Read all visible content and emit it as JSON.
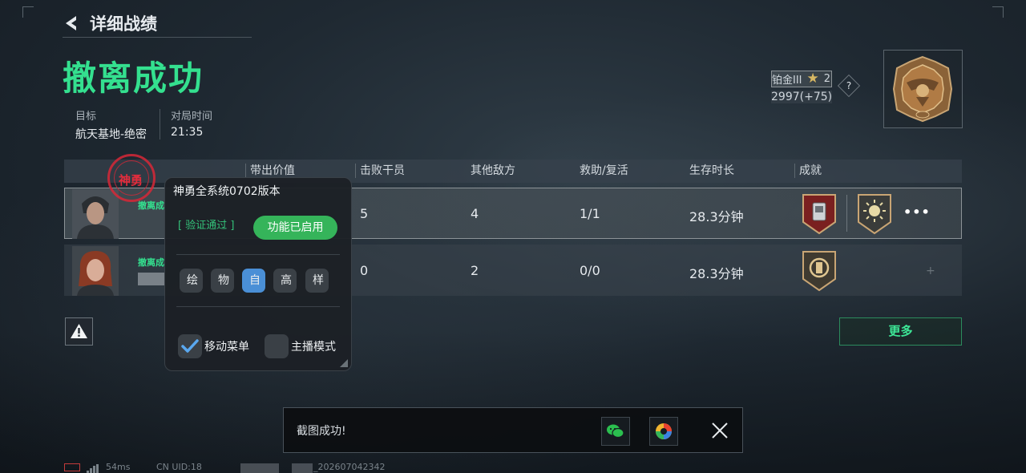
{
  "header": {
    "back_label": "详细战绩",
    "result": "撤离成功"
  },
  "meta": {
    "target_label": "目标",
    "target_value": "航天基地-绝密",
    "time_label": "对局时间",
    "time_value": "21:35"
  },
  "rank": {
    "tier": "铂金III",
    "stars": "2",
    "score": "2997(+75)",
    "help": "?"
  },
  "table": {
    "headers": [
      "带出价值",
      "击败干员",
      "其他敌方",
      "救助/复活",
      "生存时长",
      "成就"
    ],
    "rows": [
      {
        "name": "撤离成",
        "kills": "5",
        "others": "4",
        "assists": "1/1",
        "survival": "28.3分钟",
        "more": "•••"
      },
      {
        "name": "撤离成",
        "kills": "0",
        "others": "2",
        "assists": "0/0",
        "survival": "28.3分钟"
      }
    ]
  },
  "stamp": {
    "text": "神勇"
  },
  "popup": {
    "title": "神勇全系统0702版本",
    "verified": "[ 验证通过 ]",
    "enabled_button": "功能已启用",
    "chips": [
      "绘",
      "物",
      "自",
      "高",
      "样"
    ],
    "move_menu_label": "移动菜单",
    "streamer_label": "主播模式"
  },
  "buttons": {
    "more": "更多"
  },
  "toast": {
    "text": "截图成功!"
  },
  "status": {
    "ping": "54ms",
    "uid": "CN UID:18",
    "code": "_202607042342"
  },
  "colors": {
    "accent_green": "#34e08f",
    "enabled_green": "#35b45a",
    "chip_active": "#4a8fd6",
    "stamp_red": "#e42c3c"
  }
}
